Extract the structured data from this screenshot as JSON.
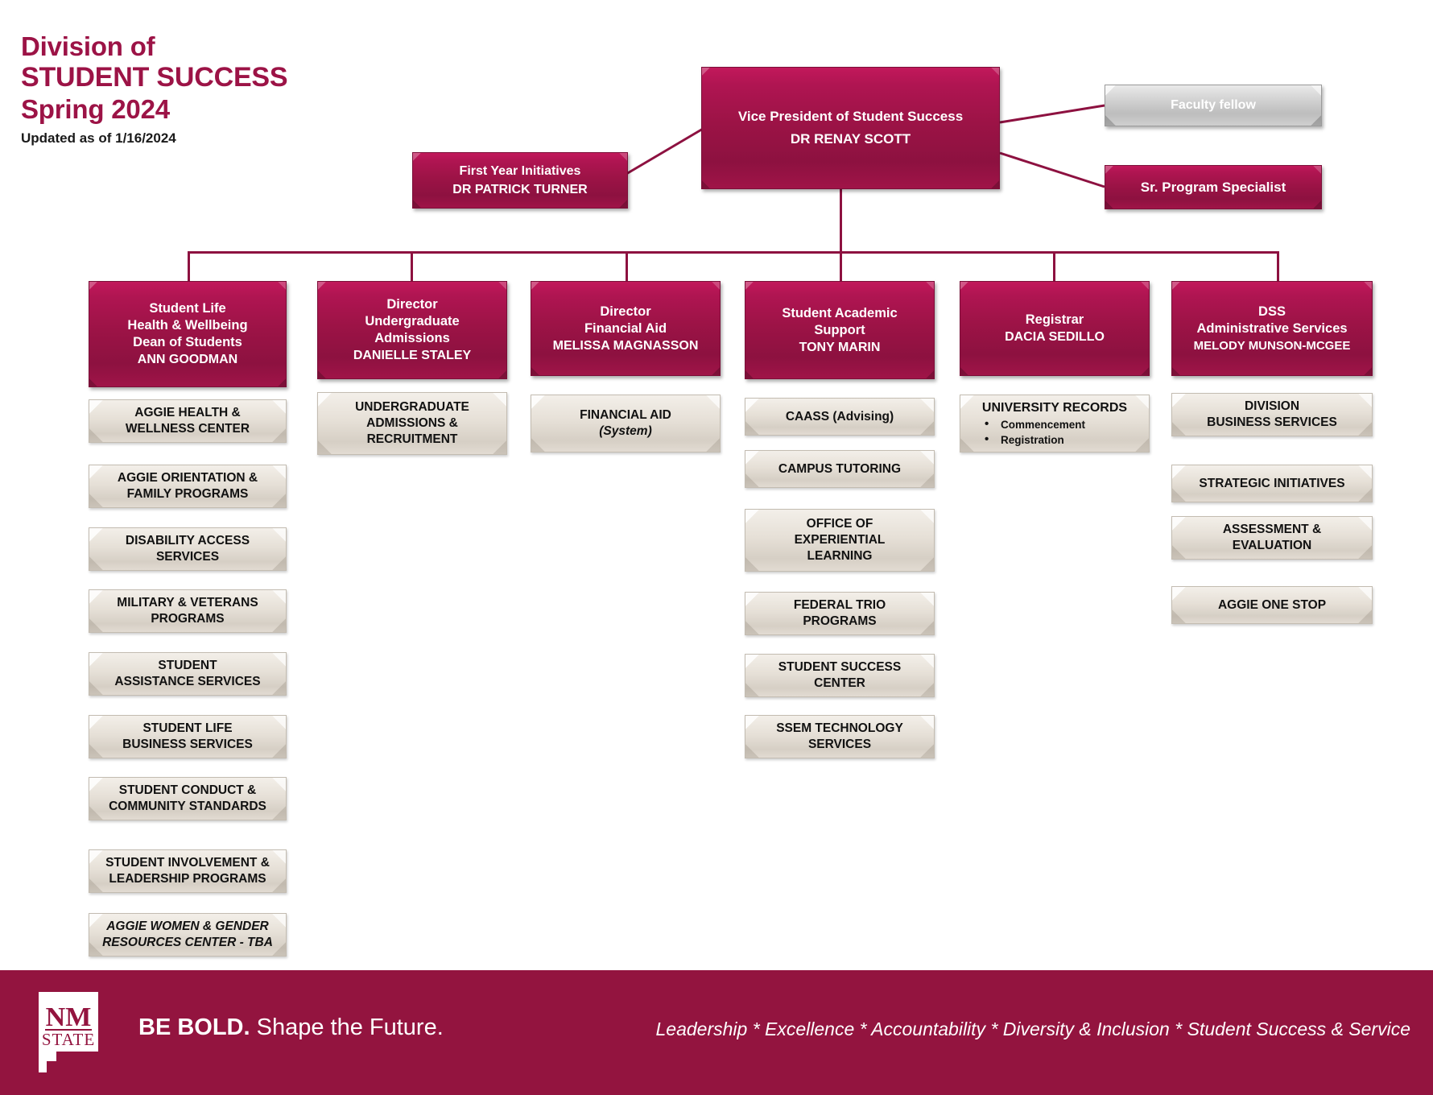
{
  "header": {
    "line1": "Division of",
    "line2": "STUDENT SUCCESS",
    "line3": "Spring 2024",
    "updated": "Updated as of 1/16/2024"
  },
  "colors": {
    "maroon": "#9c1346",
    "footer_maroon": "#93143f",
    "silver": "#cfcfcf",
    "tan": "#e6e0d7"
  },
  "executive": {
    "vp": {
      "title": "Vice President of Student Success",
      "name": "DR RENAY SCOTT"
    },
    "first_year": {
      "title": "First Year Initiatives",
      "name": "DR PATRICK TURNER"
    },
    "faculty_fellow": {
      "title": "Faculty fellow"
    },
    "sr_program_specialist": {
      "title": "Sr. Program Specialist"
    }
  },
  "columns": [
    {
      "head": {
        "title_lines": [
          "Student Life",
          "Health & Wellbeing",
          "Dean of Students"
        ],
        "name": "ANN GOODMAN"
      },
      "units": [
        {
          "lines": [
            "AGGIE HEALTH &",
            "WELLNESS CENTER"
          ]
        },
        {
          "lines": [
            "AGGIE ORIENTATION &",
            "FAMILY PROGRAMS"
          ]
        },
        {
          "lines": [
            "DISABILITY ACCESS",
            "SERVICES"
          ]
        },
        {
          "lines": [
            "MILITARY & VETERANS",
            "PROGRAMS"
          ]
        },
        {
          "lines": [
            "STUDENT",
            "ASSISTANCE SERVICES"
          ]
        },
        {
          "lines": [
            "STUDENT LIFE",
            "BUSINESS SERVICES"
          ]
        },
        {
          "lines": [
            "STUDENT CONDUCT &",
            "COMMUNITY STANDARDS"
          ]
        },
        {
          "lines": [
            "STUDENT INVOLVEMENT &",
            "LEADERSHIP PROGRAMS"
          ]
        },
        {
          "lines": [
            "AGGIE WOMEN & GENDER",
            "RESOURCES CENTER - TBA"
          ],
          "italic": true
        }
      ]
    },
    {
      "head": {
        "title_lines": [
          "Director",
          "Undergraduate",
          "Admissions"
        ],
        "name": "DANIELLE STALEY"
      },
      "units": [
        {
          "lines": [
            "UNDERGRADUATE",
            "ADMISSIONS &",
            "RECRUITMENT"
          ]
        }
      ]
    },
    {
      "head": {
        "title_lines": [
          "Director",
          "Financial Aid"
        ],
        "name": "MELISSA MAGNASSON"
      },
      "units": [
        {
          "lines": [
            "FINANCIAL AID"
          ],
          "sub": "(System)"
        }
      ]
    },
    {
      "head": {
        "title_lines": [
          "Student Academic",
          "Support"
        ],
        "name": "TONY MARIN"
      },
      "units": [
        {
          "lines": [
            "CAASS (Advising)"
          ]
        },
        {
          "lines": [
            "CAMPUS TUTORING"
          ]
        },
        {
          "lines": [
            "OFFICE OF",
            "EXPERIENTIAL",
            "LEARNING"
          ]
        },
        {
          "lines": [
            "FEDERAL TRIO",
            "PROGRAMS"
          ]
        },
        {
          "lines": [
            "STUDENT SUCCESS",
            "CENTER"
          ]
        },
        {
          "lines": [
            "SSEM TECHNOLOGY",
            "SERVICES"
          ]
        }
      ]
    },
    {
      "head": {
        "title_lines": [
          "Registrar"
        ],
        "name": "DACIA SEDILLO"
      },
      "units": [
        {
          "lines": [
            "UNIVERSITY RECORDS"
          ],
          "bullets": [
            "Commencement",
            "Registration"
          ]
        }
      ]
    },
    {
      "head": {
        "title_lines": [
          "DSS",
          "Administrative Services"
        ],
        "name": "MELODY MUNSON-MCGEE"
      },
      "units": [
        {
          "lines": [
            "DIVISION",
            "BUSINESS SERVICES"
          ]
        },
        {
          "lines": [
            "STRATEGIC INITIATIVES"
          ]
        },
        {
          "lines": [
            "ASSESSMENT &",
            "EVALUATION"
          ]
        },
        {
          "lines": [
            "AGGIE ONE STOP"
          ]
        }
      ]
    }
  ],
  "footer": {
    "logo_line1": "NM",
    "logo_line2": "STATE",
    "tagline_bold": "BE BOLD.",
    "tagline_rest": " Shape the Future.",
    "values": "Leadership * Excellence * Accountability * Diversity & Inclusion * Student Success & Service"
  }
}
